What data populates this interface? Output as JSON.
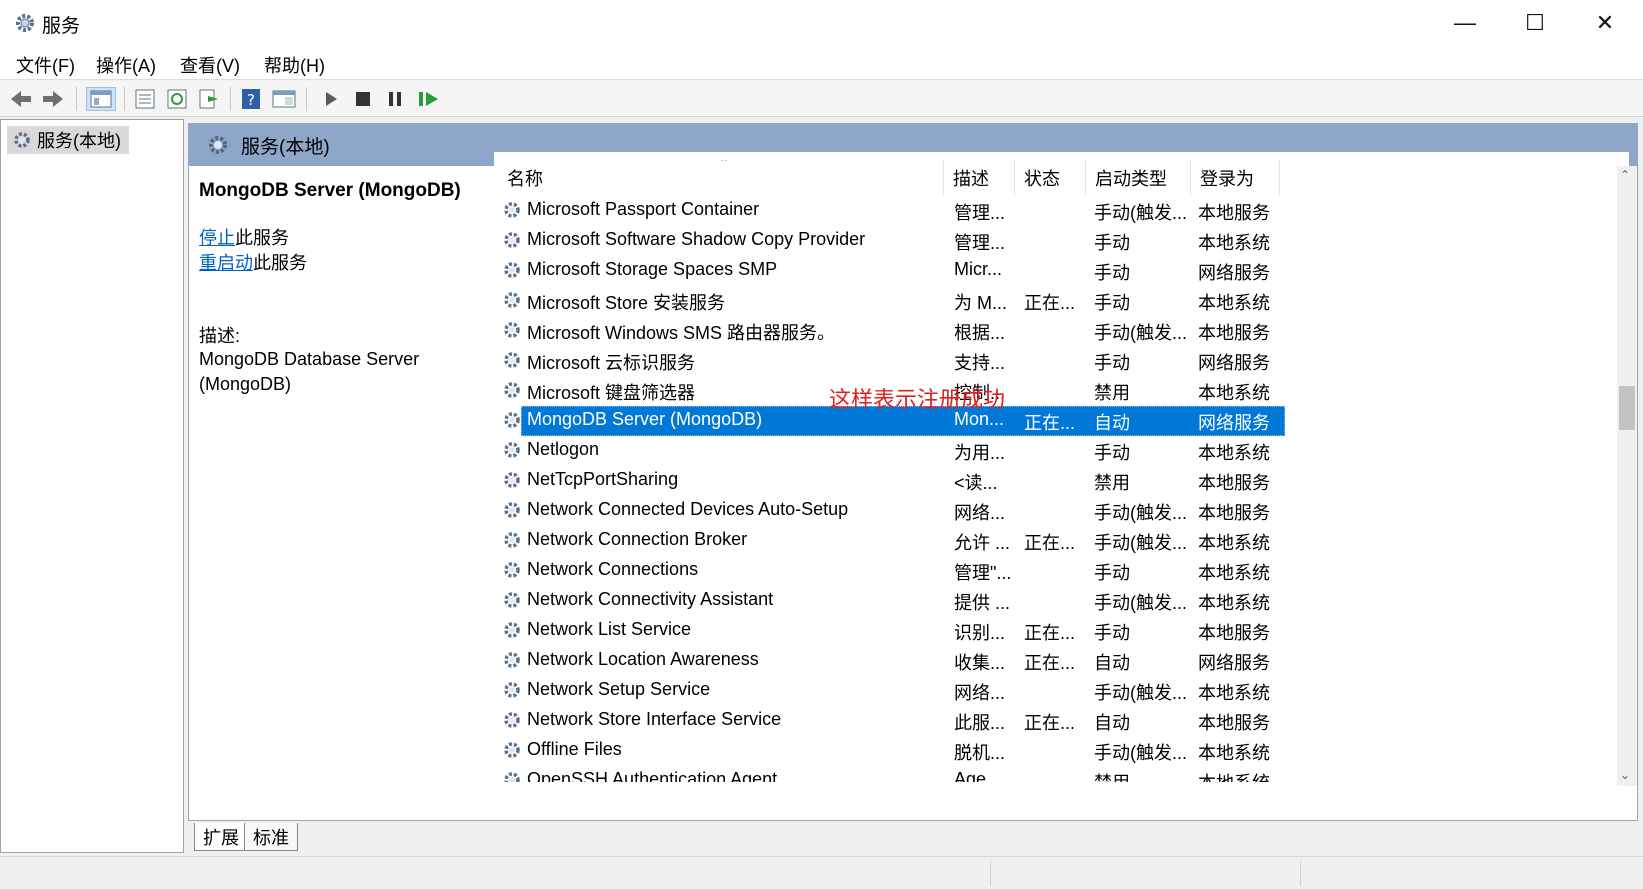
{
  "window": {
    "title": "服务",
    "controls": {
      "minimize": "—",
      "maximize": "☐",
      "close": "✕"
    }
  },
  "menu": [
    "文件(F)",
    "操作(A)",
    "查看(V)",
    "帮助(H)"
  ],
  "toolbar": [
    "back-icon",
    "forward-icon",
    "show-tree-icon",
    "properties-icon",
    "refresh-icon",
    "export-icon",
    "help-icon",
    "view-icon",
    "play-icon",
    "stop-icon",
    "pause-icon",
    "resume-icon"
  ],
  "tree": {
    "root": "服务(本地)"
  },
  "header": {
    "title": "服务(本地)"
  },
  "detail": {
    "service_name": "MongoDB Server (MongoDB)",
    "stop_link": "停止",
    "stop_suffix": "此服务",
    "restart_link": "重启动",
    "restart_suffix": "此服务",
    "desc_label": "描述:",
    "desc_text": "MongoDB Database Server (MongoDB)"
  },
  "columns": {
    "name": "名称",
    "desc": "描述",
    "status": "状态",
    "startup": "启动类型",
    "logon": "登录为"
  },
  "services": [
    {
      "name": "Microsoft Passport Container",
      "desc": "管理...",
      "status": "",
      "startup": "手动(触发...",
      "logon": "本地服务"
    },
    {
      "name": "Microsoft Software Shadow Copy Provider",
      "desc": "管理...",
      "status": "",
      "startup": "手动",
      "logon": "本地系统"
    },
    {
      "name": "Microsoft Storage Spaces SMP",
      "desc": "Micr...",
      "status": "",
      "startup": "手动",
      "logon": "网络服务"
    },
    {
      "name": "Microsoft Store 安装服务",
      "desc": "为 M...",
      "status": "正在...",
      "startup": "手动",
      "logon": "本地系统"
    },
    {
      "name": "Microsoft Windows SMS 路由器服务。",
      "desc": "根据...",
      "status": "",
      "startup": "手动(触发...",
      "logon": "本地服务"
    },
    {
      "name": "Microsoft 云标识服务",
      "desc": "支持...",
      "status": "",
      "startup": "手动",
      "logon": "网络服务"
    },
    {
      "name": "Microsoft 键盘筛选器",
      "desc": "控制...",
      "status": "",
      "startup": "禁用",
      "logon": "本地系统"
    },
    {
      "name": "MongoDB Server (MongoDB)",
      "desc": "Mon...",
      "status": "正在...",
      "startup": "自动",
      "logon": "网络服务",
      "selected": true
    },
    {
      "name": "Netlogon",
      "desc": "为用...",
      "status": "",
      "startup": "手动",
      "logon": "本地系统"
    },
    {
      "name": "NetTcpPortSharing",
      "desc": "<读...",
      "status": "",
      "startup": "禁用",
      "logon": "本地服务"
    },
    {
      "name": "Network Connected Devices Auto-Setup",
      "desc": "网络...",
      "status": "",
      "startup": "手动(触发...",
      "logon": "本地服务"
    },
    {
      "name": "Network Connection Broker",
      "desc": "允许 ...",
      "status": "正在...",
      "startup": "手动(触发...",
      "logon": "本地系统"
    },
    {
      "name": "Network Connections",
      "desc": "管理\"...",
      "status": "",
      "startup": "手动",
      "logon": "本地系统"
    },
    {
      "name": "Network Connectivity Assistant",
      "desc": "提供 ...",
      "status": "",
      "startup": "手动(触发...",
      "logon": "本地系统"
    },
    {
      "name": "Network List Service",
      "desc": "识别...",
      "status": "正在...",
      "startup": "手动",
      "logon": "本地服务"
    },
    {
      "name": "Network Location Awareness",
      "desc": "收集...",
      "status": "正在...",
      "startup": "自动",
      "logon": "网络服务"
    },
    {
      "name": "Network Setup Service",
      "desc": "网络...",
      "status": "",
      "startup": "手动(触发...",
      "logon": "本地系统"
    },
    {
      "name": "Network Store Interface Service",
      "desc": "此服...",
      "status": "正在...",
      "startup": "自动",
      "logon": "本地服务"
    },
    {
      "name": "Offline Files",
      "desc": "脱机...",
      "status": "",
      "startup": "手动(触发...",
      "logon": "本地系统"
    },
    {
      "name": "OpenSSH Authentication Agent",
      "desc": "Age...",
      "status": "",
      "startup": "禁用",
      "logon": "本地系统"
    }
  ],
  "annotation": "这样表示注册成功",
  "tabs": [
    "扩展",
    "标准"
  ],
  "colors": {
    "selection": "#0078d7",
    "header_band": "#8ea6c8",
    "link": "#0060c8",
    "annotation": "#e02020"
  }
}
